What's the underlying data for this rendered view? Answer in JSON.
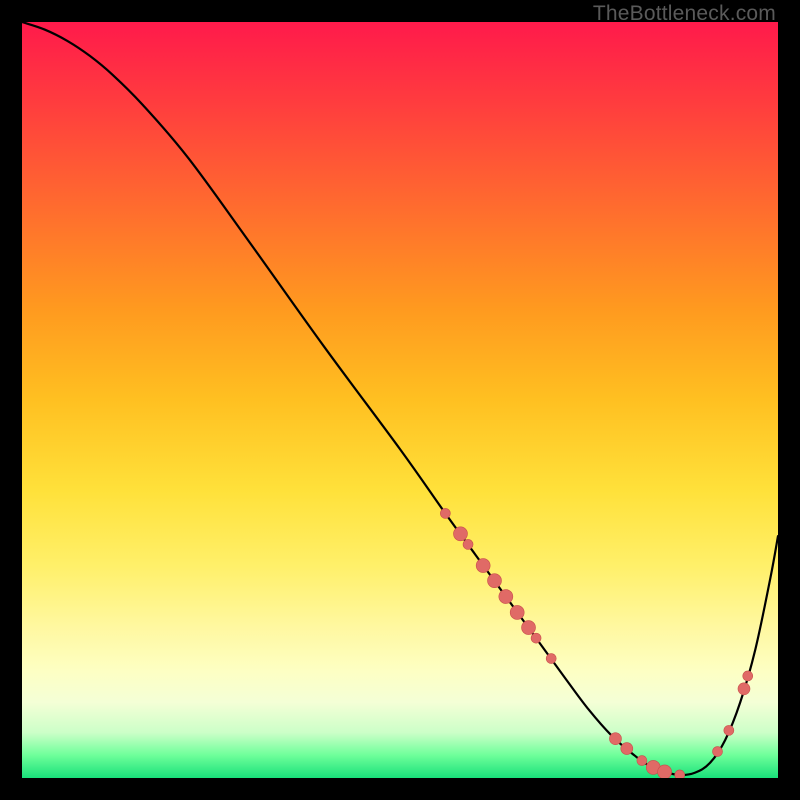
{
  "watermark": "TheBottleneck.com",
  "colors": {
    "page_bg": "#000000",
    "curve": "#000000",
    "marker_fill": "#e06a66",
    "marker_stroke": "#c94f4b"
  },
  "chart_data": {
    "type": "line",
    "title": "",
    "xlabel": "",
    "ylabel": "",
    "xlim": [
      0,
      100
    ],
    "ylim": [
      0,
      100
    ],
    "grid": false,
    "legend": false,
    "series": [
      {
        "name": "curve",
        "x": [
          0,
          3,
          6,
          9,
          12,
          16,
          22,
          30,
          40,
          50,
          56,
          60,
          64,
          68,
          72,
          75,
          78,
          81,
          83,
          85,
          87,
          89,
          91,
          93,
          95,
          97,
          99,
          100
        ],
        "y": [
          100,
          99,
          97.5,
          95.5,
          93,
          89,
          82,
          71,
          57,
          43.5,
          35,
          29.5,
          24,
          18.5,
          13,
          9,
          5.6,
          3,
          1.6,
          0.8,
          0.4,
          0.7,
          2,
          5,
          10,
          17,
          26.5,
          32
        ]
      }
    ],
    "markers": {
      "name": "highlighted-points",
      "points": [
        {
          "x": 56.0,
          "y": 35.0,
          "r": 5
        },
        {
          "x": 58.0,
          "y": 32.3,
          "r": 7
        },
        {
          "x": 59.0,
          "y": 30.9,
          "r": 5
        },
        {
          "x": 61.0,
          "y": 28.1,
          "r": 7
        },
        {
          "x": 62.5,
          "y": 26.1,
          "r": 7
        },
        {
          "x": 64.0,
          "y": 24.0,
          "r": 7
        },
        {
          "x": 65.5,
          "y": 21.9,
          "r": 7
        },
        {
          "x": 67.0,
          "y": 19.9,
          "r": 7
        },
        {
          "x": 68.0,
          "y": 18.5,
          "r": 5
        },
        {
          "x": 70.0,
          "y": 15.8,
          "r": 5
        },
        {
          "x": 78.5,
          "y": 5.2,
          "r": 6
        },
        {
          "x": 80.0,
          "y": 3.9,
          "r": 6
        },
        {
          "x": 82.0,
          "y": 2.3,
          "r": 5
        },
        {
          "x": 83.5,
          "y": 1.4,
          "r": 7
        },
        {
          "x": 85.0,
          "y": 0.8,
          "r": 7
        },
        {
          "x": 87.0,
          "y": 0.4,
          "r": 5
        },
        {
          "x": 92.0,
          "y": 3.5,
          "r": 5
        },
        {
          "x": 93.5,
          "y": 6.3,
          "r": 5
        },
        {
          "x": 95.5,
          "y": 11.8,
          "r": 6
        },
        {
          "x": 96.0,
          "y": 13.5,
          "r": 5
        }
      ]
    }
  }
}
